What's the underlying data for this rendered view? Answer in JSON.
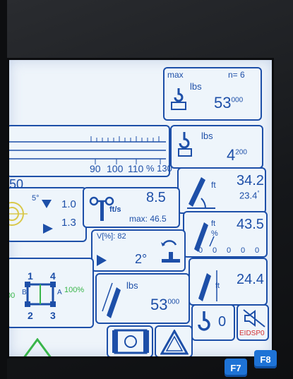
{
  "max_load": {
    "label": "max",
    "n_label": "n= 6",
    "unit": "lbs",
    "value": "53",
    "value_sup": "000"
  },
  "hook_load": {
    "unit": "lbs",
    "value": "4",
    "value_sup": "200"
  },
  "utilization_bar": {
    "ticks": [
      "90",
      "100",
      "110",
      "% 130"
    ]
  },
  "left_value": "50",
  "boom": {
    "unit": "ft",
    "length": "34.2",
    "angle": "23.4",
    "angle_sup": "°"
  },
  "tilt": {
    "angle_label": "5°",
    "value_top": "1.0",
    "value_bottom": "1.3"
  },
  "wind": {
    "value": "8.5",
    "unit": "ft/s",
    "max_label": "max: 46.5"
  },
  "radius": {
    "unit_ft": "ft",
    "unit_pct": "%",
    "value": "43.5",
    "zeros": [
      "0",
      "0",
      "0",
      "0",
      "0"
    ]
  },
  "slew": {
    "v_label": "V[%]: 82",
    "angle": "2°"
  },
  "outriggers": {
    "labels": [
      "1",
      "4",
      "2",
      "3",
      "B",
      "A"
    ],
    "percent_left": "00",
    "percent_right": "100%"
  },
  "boom_force": {
    "unit": "lbs",
    "value": "53",
    "value_sup": "000"
  },
  "height": {
    "unit": "ft",
    "value": "24.4"
  },
  "hook_counter": "0",
  "eidsp_label": "EIDSP0",
  "fkeys": [
    "F7",
    "F8"
  ],
  "colors": {
    "accent": "#1d4fa8",
    "screen": "#eef4fa",
    "fkey": "#1e73d6",
    "warning": "#d32f2f",
    "green": "#39b54a"
  }
}
